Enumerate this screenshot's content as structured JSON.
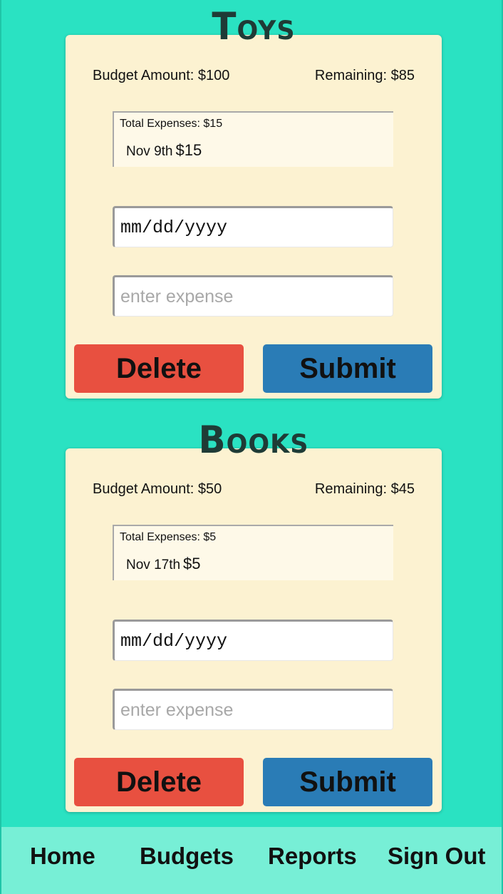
{
  "budgets": [
    {
      "name": "Toys",
      "budget_amount": "Budget Amount: $100",
      "remaining": "Remaining: $85",
      "total_expenses": "Total Expenses: $15",
      "entry_date": "Nov 9th",
      "entry_amount": "$15",
      "date_placeholder": "mm/dd/yyyy",
      "expense_placeholder": "enter expense",
      "delete_label": "Delete",
      "submit_label": "Submit"
    },
    {
      "name": "Books",
      "budget_amount": "Budget Amount: $50",
      "remaining": "Remaining: $45",
      "total_expenses": "Total Expenses: $5",
      "entry_date": "Nov 17th",
      "entry_amount": "$5",
      "date_placeholder": "mm/dd/yyyy",
      "expense_placeholder": "enter expense",
      "delete_label": "Delete",
      "submit_label": "Submit"
    }
  ],
  "nav": {
    "home": "Home",
    "budgets": "Budgets",
    "reports": "Reports",
    "sign_out": "Sign Out"
  },
  "colors": {
    "background": "#2ae2c2",
    "card": "#fcf2d1",
    "delete": "#e85040",
    "submit": "#2a7cb6",
    "navbar": "#77efd6"
  }
}
